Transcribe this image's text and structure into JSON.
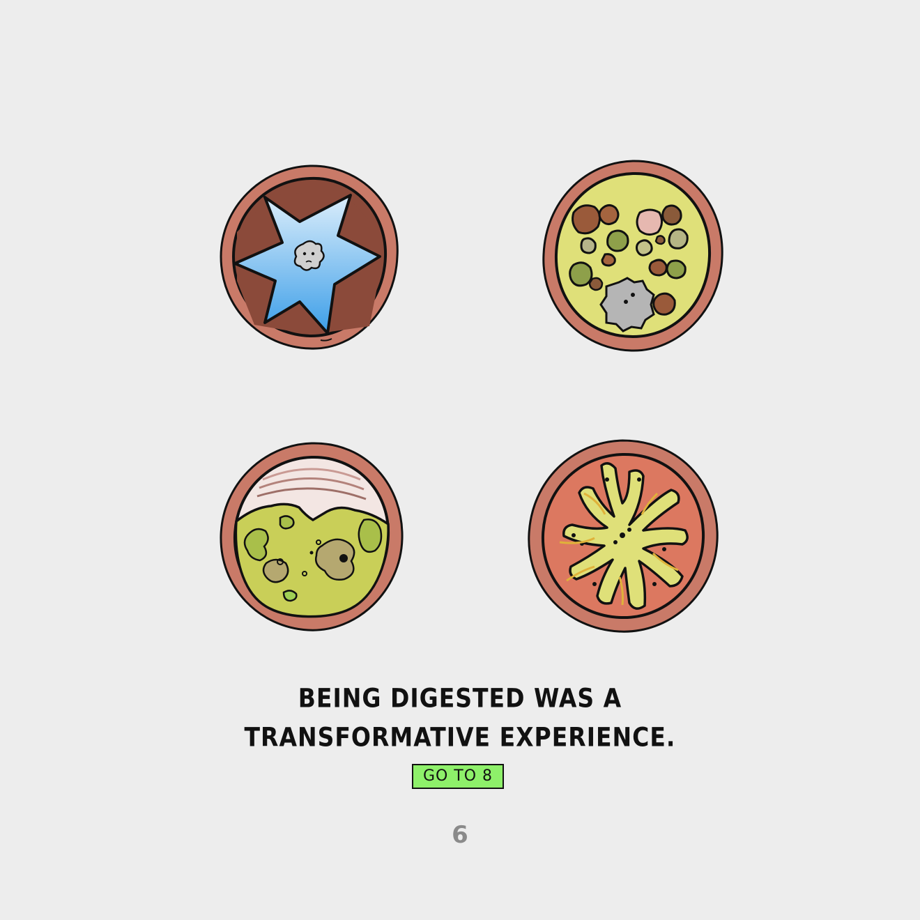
{
  "caption": {
    "line1": "BEING DIGESTED WAS A",
    "line2": "TRANSFORMATIVE EXPERIENCE."
  },
  "choice": {
    "label": "GO TO 8"
  },
  "page_number": "6",
  "colors": {
    "background": "#ededed",
    "tube_wall": "#c97a68",
    "goto_button": "#8ef06a",
    "page_number": "#8a8a8a"
  },
  "panels": [
    {
      "name": "stomach-star-cross-section",
      "icon": "blue-star-lumen-with-creature"
    },
    {
      "name": "chunky-digestion-cross-section",
      "icon": "yellow-lumen-with-food-chunks"
    },
    {
      "name": "bile-cross-section",
      "icon": "green-mush-with-layered-tissue"
    },
    {
      "name": "intestine-villi-cross-section",
      "icon": "red-folds-with-yellow-villi"
    }
  ]
}
